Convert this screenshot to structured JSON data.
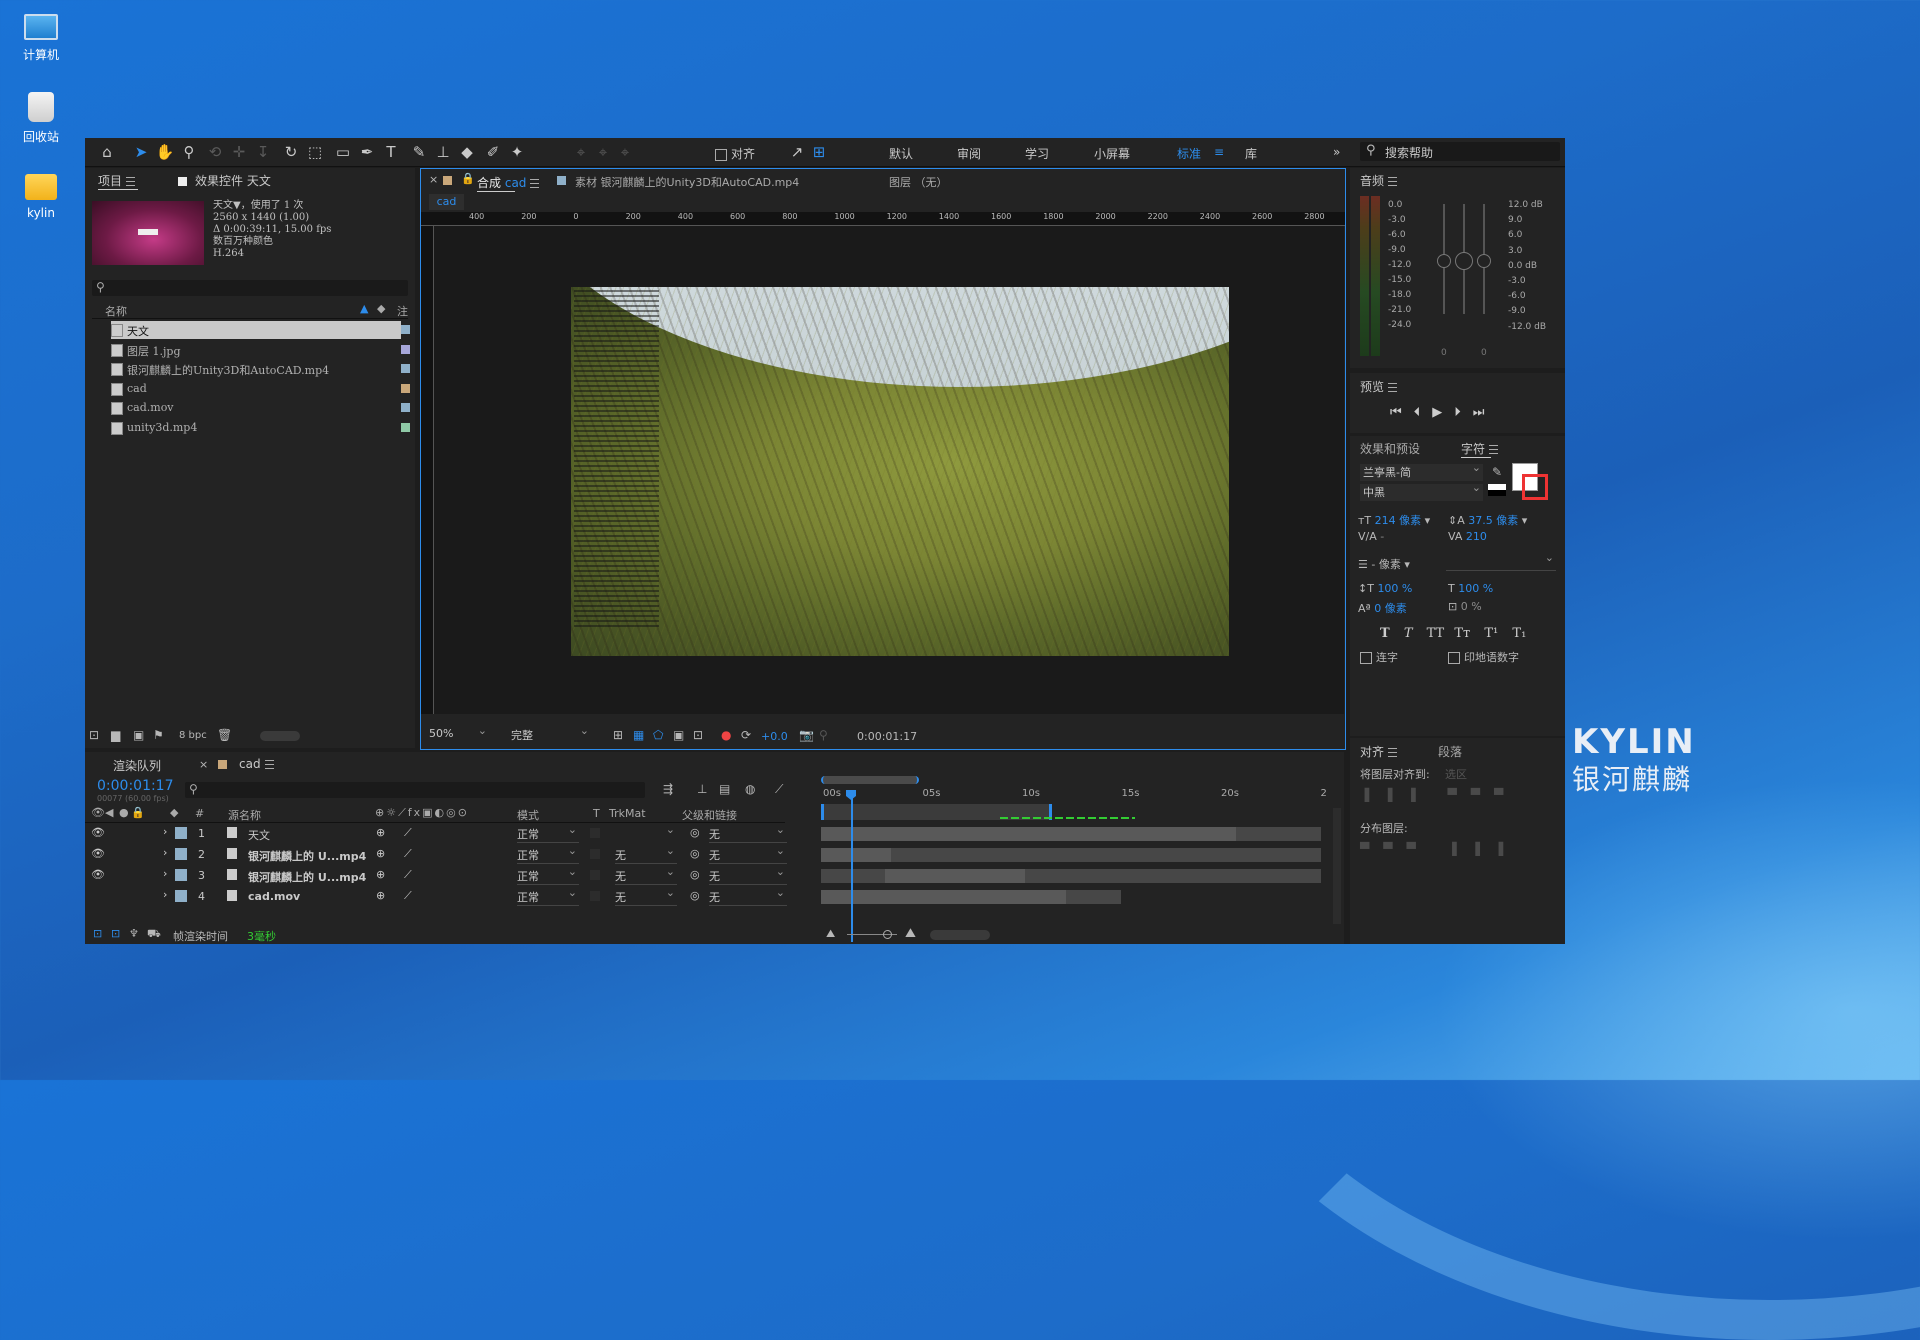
{
  "desktop": {
    "icons": [
      {
        "label": "计算机"
      },
      {
        "label": "回收站"
      },
      {
        "label": "kylin"
      }
    ],
    "brand_en": "KYLIN",
    "brand_cn": "银河麒麟"
  },
  "toolbar": {
    "align_label": "对齐",
    "workspaces": [
      "默认",
      "审阅",
      "学习",
      "小屏幕",
      "标准",
      "库"
    ],
    "active_workspace": "标准",
    "search_placeholder": "搜索帮助"
  },
  "project_panel": {
    "tab_project": "项目",
    "tab_effects": "效果控件 天文",
    "info": {
      "name_line": "天文▼，使用了 1 次",
      "resolution": "2560 x 1440 (1.00)",
      "duration": "Δ 0:00:39:11, 15.00 fps",
      "color": "数百万种颜色",
      "codec": "H.264"
    },
    "col_name": "名称",
    "col_note": "注",
    "items": [
      {
        "name": "天文",
        "color": "#8fb0c9"
      },
      {
        "name": "图层 1.jpg",
        "color": "#a6a6d9"
      },
      {
        "name": "银河麒麟上的Unity3D和AutoCAD.mp4",
        "color": "#8fb0c9"
      },
      {
        "name": "cad",
        "color": "#c9a77a"
      },
      {
        "name": "cad.mov",
        "color": "#8fb0c9"
      },
      {
        "name": "unity3d.mp4",
        "color": "#8fc9a6"
      }
    ],
    "bpc": "8 bpc"
  },
  "comp_panel": {
    "tab_comp_prefix": "合成",
    "tab_comp_name": "cad",
    "tab_footage": "素材 银河麒麟上的Unity3D和AutoCAD.mp4",
    "tab_layer": "图层 （无）",
    "subtab": "cad",
    "ruler_labels": [
      "400",
      "200",
      "0",
      "200",
      "400",
      "600",
      "800",
      "1000",
      "1200",
      "1400",
      "1600",
      "1800",
      "2000",
      "2200",
      "2400",
      "2600",
      "2800"
    ],
    "zoom": "50%",
    "quality": "完整",
    "exposure": "+0.0",
    "timecode": "0:00:01:17"
  },
  "audio_panel": {
    "title": "音频",
    "left_scale": [
      "0.0",
      "-3.0",
      "-6.0",
      "-9.0",
      "-12.0",
      "-15.0",
      "-18.0",
      "-21.0",
      "-24.0"
    ],
    "right_scale": [
      "12.0 dB",
      "9.0",
      "6.0",
      "3.0",
      "0.0 dB",
      "-3.0",
      "-6.0",
      "-9.0",
      "-12.0 dB"
    ],
    "zero_a": "0",
    "zero_b": "0"
  },
  "preview_panel": {
    "title": "预览"
  },
  "character_panel": {
    "tab_effects": "效果和预设",
    "tab_char": "字符",
    "font": "兰亭黑-简",
    "style": "中黑",
    "size": "214 像素",
    "leading": "37.5 像素",
    "kerning": "-",
    "tracking": "210",
    "stroke": "- 像素",
    "vscale": "100 %",
    "hscale": "100 %",
    "baseline": "0 像素",
    "tsume": "0 %",
    "styles": [
      "T",
      "T",
      "TT",
      "Tт",
      "T¹",
      "T₁"
    ],
    "ligatures": "连字",
    "hindi": "印地语数字"
  },
  "align_panel": {
    "tab_align": "对齐",
    "tab_para": "段落",
    "align_to_label": "将图层对齐到:",
    "align_to_value": "选区",
    "distribute_label": "分布图层:"
  },
  "timeline": {
    "tab_render": "渲染队列",
    "tab_comp": "cad",
    "timecode": "0:00:01:17",
    "frames": "00077 (60.00 fps)",
    "columns": {
      "name": "源名称",
      "mode": "模式",
      "t": "T",
      "trkmat": "TrkMat",
      "parent": "父级和链接"
    },
    "ruler": [
      "00s",
      "05s",
      "10s",
      "15s",
      "20s",
      "2"
    ],
    "layers": [
      {
        "num": "1",
        "name": "天文",
        "mode": "正常",
        "trkmat": "",
        "parent": "无",
        "color": "#8fb0c9"
      },
      {
        "num": "2",
        "name": "银河麒麟上的 U...mp4",
        "mode": "正常",
        "trkmat": "无",
        "parent": "无",
        "color": "#8fb0c9"
      },
      {
        "num": "3",
        "name": "银河麒麟上的 U...mp4",
        "mode": "正常",
        "trkmat": "无",
        "parent": "无",
        "color": "#8fb0c9"
      },
      {
        "num": "4",
        "name": "cad.mov",
        "mode": "正常",
        "trkmat": "无",
        "parent": "无",
        "color": "#8fb0c9"
      }
    ],
    "render_label": "帧渲染时间",
    "render_value": "3毫秒"
  }
}
